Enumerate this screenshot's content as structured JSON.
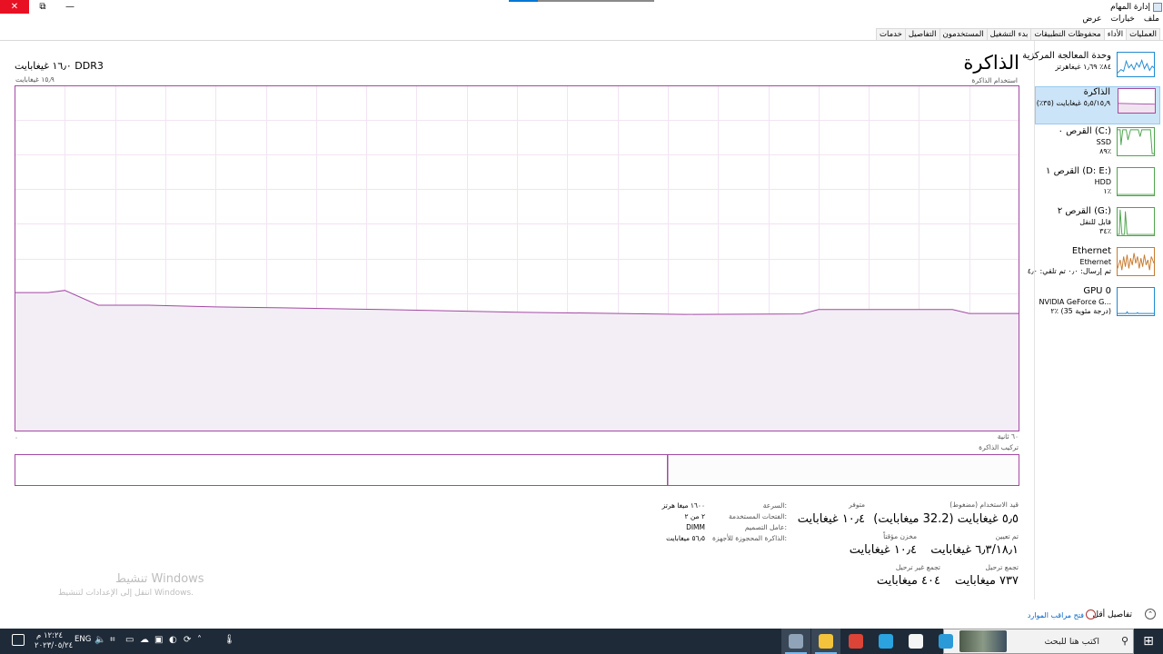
{
  "window": {
    "title": "إدارة المهام",
    "buttons": {
      "close": "✕",
      "restore": "⧉",
      "minimize": "—"
    }
  },
  "menu": {
    "items": [
      "ملف",
      "خيارات",
      "عرض"
    ]
  },
  "tabs": [
    {
      "label": "العمليات",
      "active": false
    },
    {
      "label": "الأداء",
      "active": true
    },
    {
      "label": "محفوظات التطبيقات",
      "active": false
    },
    {
      "label": "بدء التشغيل",
      "active": false
    },
    {
      "label": "المستخدمون",
      "active": false
    },
    {
      "label": "التفاصيل",
      "active": false
    },
    {
      "label": "خدمات",
      "active": false
    }
  ],
  "sidebar": [
    {
      "title": "وحدة المعالجة المركزية",
      "line2": "٨٤٪ ١٫٦٩ غيغاهرتز",
      "line3": "",
      "color": "#1f8ad2",
      "selected": false
    },
    {
      "title": "الذاكرة",
      "line2": "٥٫٥/١٥٫٩ غيغابايت (٣٥٪)",
      "line3": "",
      "color": "#a349a4",
      "selected": true
    },
    {
      "title": "القرص ٠ (C:)",
      "line2": "SSD",
      "line3": "٨٩٪",
      "color": "#4da54d",
      "selected": false
    },
    {
      "title": "القرص ١ (D: E:)",
      "line2": "HDD",
      "line3": "١٪",
      "color": "#4da54d",
      "selected": false
    },
    {
      "title": "القرص ٢ (G:)",
      "line2": "قابل للنقل",
      "line3": "٣٤٪",
      "color": "#4da54d",
      "selected": false
    },
    {
      "title": "Ethernet",
      "line2": "Ethernet",
      "line3": "تم إرسال: ٠٫٠ تم تلقي: ٤٫٠",
      "color": "#c87b2e",
      "selected": false
    },
    {
      "title": "GPU 0",
      "line2": "NVIDIA GeForce G...",
      "line3": "٢٪ (35 درجة مئوية)",
      "color": "#1f8ad2",
      "selected": false
    }
  ],
  "main": {
    "title": "الذاكرة",
    "subtitle": "استخدام الذاكرة",
    "memory_type": "١٦٫٠ غيغابايت DDR3",
    "max_label": "١٥٫٩ غيغابايت",
    "axis_left": "٠",
    "axis_right": "٦٠ ثانية",
    "composition_title": "تركيب الذاكرة"
  },
  "chart_data": {
    "type": "area",
    "title": "استخدام الذاكرة",
    "xlabel": "٦٠ ثانية",
    "ylabel": "",
    "ylim": [
      0,
      15.9
    ],
    "xlim": [
      60,
      0
    ],
    "x": [
      60,
      58,
      57,
      55,
      52,
      48,
      44,
      38,
      30,
      20,
      13,
      12,
      6,
      4,
      3,
      0
    ],
    "values": [
      6.38,
      6.38,
      6.48,
      5.8,
      5.8,
      5.72,
      5.68,
      5.6,
      5.48,
      5.38,
      5.4,
      5.6,
      5.6,
      5.6,
      5.42,
      5.42
    ],
    "color": "#a349a4",
    "fill": "#f3eef5",
    "grid": true
  },
  "composition": {
    "in_use_fraction": 0.65
  },
  "stats": {
    "in_use_label": "قيد الاستخدام (مضغوط)",
    "in_use_value": "٥٫٥ غيغابايت (32.2 ميغابايت)",
    "available_label": "متوفر",
    "available_value": "١٠٫٤ غيغابايت",
    "committed_label": "تم تعيين",
    "committed_value": "٦٫٣/١٨٫١ غيغابايت",
    "cached_label": "مخزن مؤقتاً",
    "cached_value": "١٠٫٤ غيغابايت",
    "paged_label": "تجمع ترحيل",
    "paged_value": "٧٣٧ ميغابايت",
    "nonpaged_label": "تجمع غير ترحيل",
    "nonpaged_value": "٤٠٤ ميغابايت"
  },
  "details": {
    "speed_label": "السرعة:",
    "speed_value": "١٦٠٠ ميغا هرتز",
    "slots_label": "الفتحات المستخدمة:",
    "slots_value": "٢ من ٢",
    "form_label": "عامل التصميم:",
    "form_value": "DIMM",
    "reserved_label": "الذاكرة المحجوزة للأجهزة:",
    "reserved_value": "٥٦٫٥ ميغابايت"
  },
  "watermark": {
    "line1": "تنشيط Windows",
    "line2": "انتقل إلى الإعدادات لتنشيط Windows."
  },
  "footer": {
    "fewer_details": "تفاصيل أقل",
    "open_monitor": "فتح مراقب الموارد"
  },
  "taskbar": {
    "search_placeholder": "اكتب هنا للبحث",
    "lang": "ENG",
    "time": "١٢:٢٤ م",
    "date": "٢٠٢٣/٠٥/٢٤",
    "apps": [
      {
        "name": "task-manager",
        "color": "#8fa4b8",
        "active": true
      },
      {
        "name": "file-explorer",
        "color": "#f3c33b",
        "active": true
      },
      {
        "name": "chrome",
        "color": "#db4437",
        "active": false
      },
      {
        "name": "telegram",
        "color": "#2aa3de",
        "active": false
      },
      {
        "name": "store",
        "color": "#f5f5f5",
        "active": false
      },
      {
        "name": "edge",
        "color": "#2b9ad8",
        "active": false
      }
    ]
  }
}
